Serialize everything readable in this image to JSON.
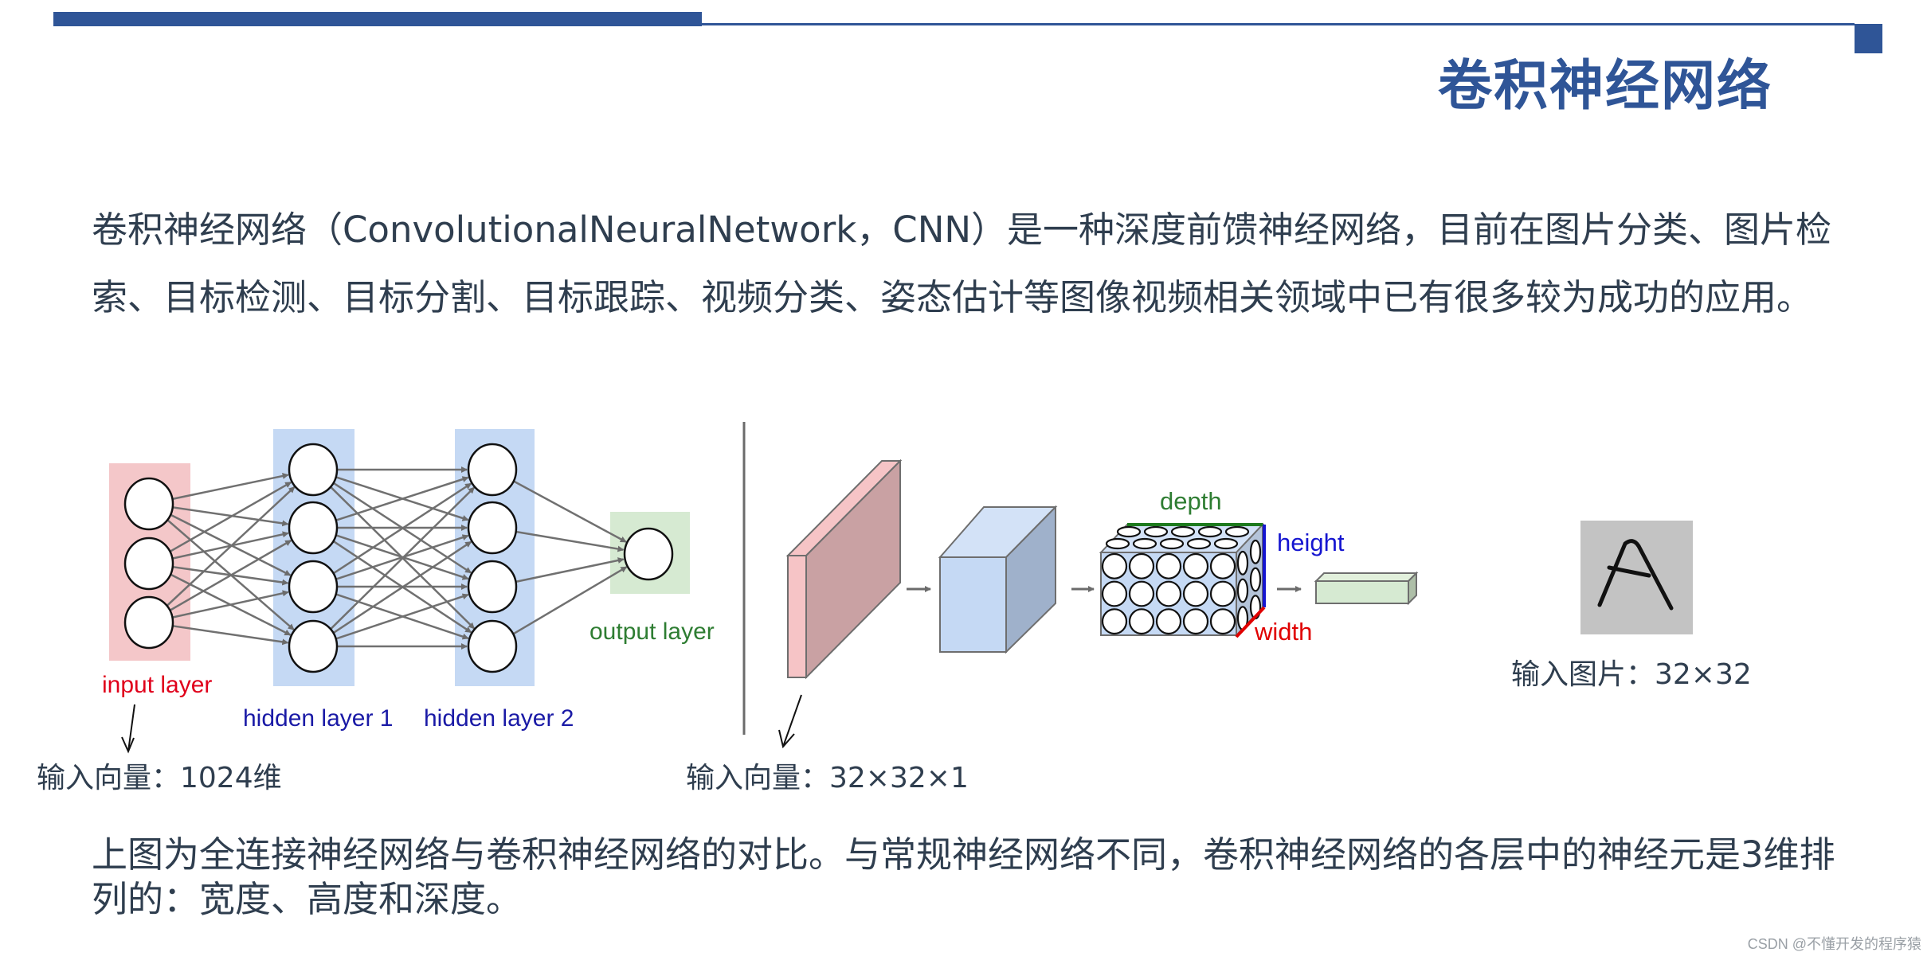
{
  "slide": {
    "title": "卷积神经网络",
    "intro_text": "卷积神经网络（ConvolutionalNeuralNetwork，CNN）是一种深度前馈神经网络，目前在图片分类、图片检索、目标检测、目标分割、目标跟踪、视频分类、姿态估计等图像视频相关领域中已有很多较为成功的应用。",
    "summary_text": "上图为全连接神经网络与卷积神经网络的对比。与常规神经网络不同，卷积神经网络的各层中的神经元是3维排列的：宽度、高度和深度。",
    "watermark": "CSDN @不懂开发的程序猿",
    "colors": {
      "accent": "#2f5597",
      "body_text": "#2f3e4f",
      "input_layer": "#f4c7c9",
      "hidden_layer": "#c5d9f4",
      "output_layer": "#d6ead2"
    }
  },
  "fc_network": {
    "labels": {
      "input": "input layer",
      "hidden1": "hidden layer 1",
      "hidden2": "hidden layer 2",
      "output": "output layer"
    },
    "layer_sizes": [
      3,
      4,
      4,
      1
    ],
    "caption": "输入向量：1024维"
  },
  "cnn_network": {
    "labels": {
      "depth": "depth",
      "height": "height",
      "width": "width"
    },
    "neuron_grid": {
      "rows": 3,
      "cols": 5
    },
    "caption": "输入向量：32×32×1"
  },
  "input_image": {
    "glyph": "A",
    "caption": "输入图片：32×32"
  }
}
